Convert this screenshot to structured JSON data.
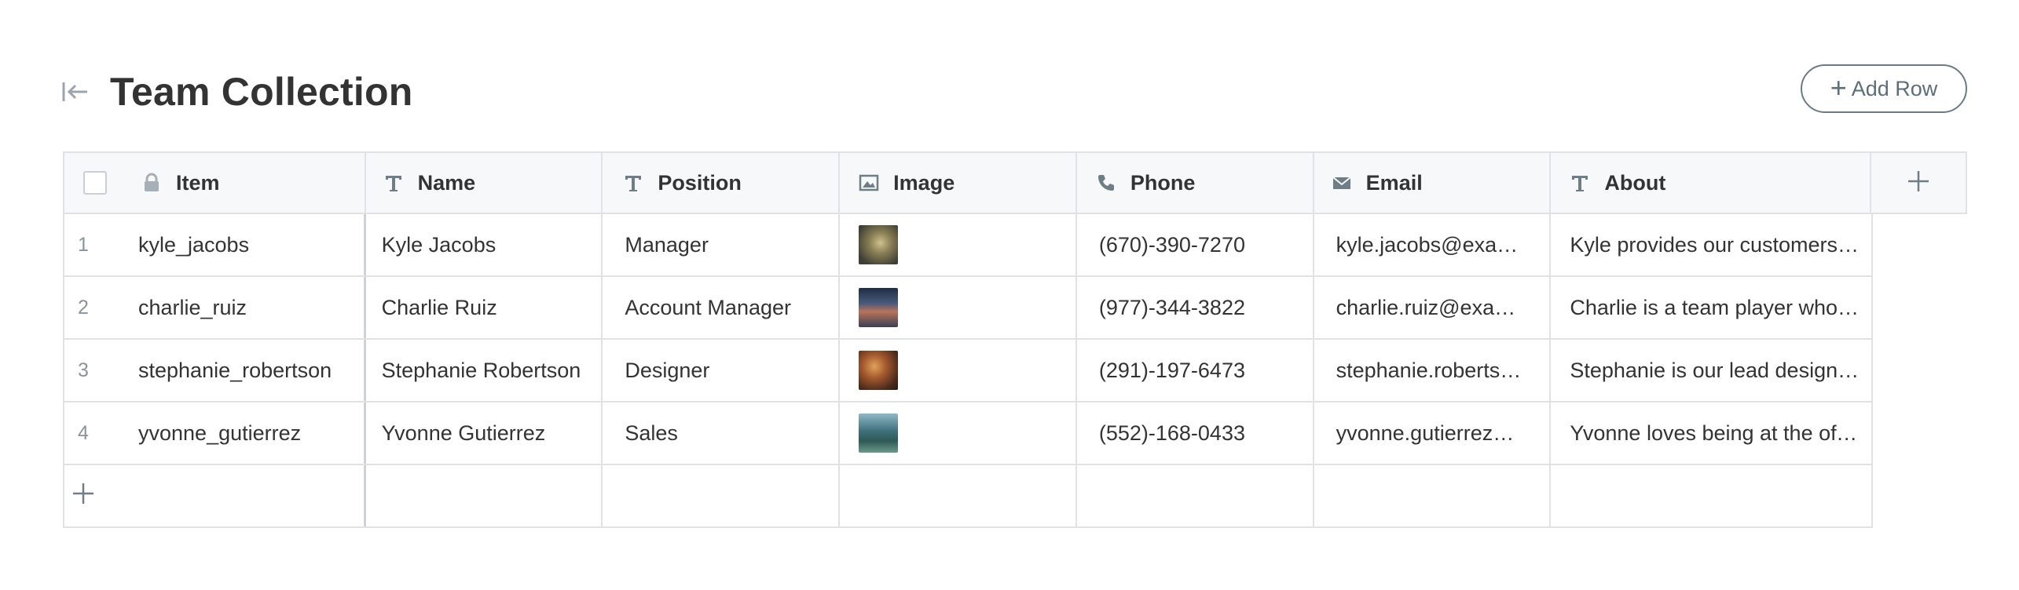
{
  "title": "Team Collection",
  "add_row_label": "Add Row",
  "columns": [
    {
      "key": "item",
      "label": "Item",
      "icon": "lock-icon"
    },
    {
      "key": "name",
      "label": "Name",
      "icon": "text-type-icon"
    },
    {
      "key": "position",
      "label": "Position",
      "icon": "text-type-icon"
    },
    {
      "key": "image",
      "label": "Image",
      "icon": "image-icon"
    },
    {
      "key": "phone",
      "label": "Phone",
      "icon": "phone-icon"
    },
    {
      "key": "email",
      "label": "Email",
      "icon": "mail-icon"
    },
    {
      "key": "about",
      "label": "About",
      "icon": "text-type-icon"
    }
  ],
  "rows": [
    {
      "index": "1",
      "item": "kyle_jacobs",
      "name": "Kyle Jacobs",
      "position": "Manager",
      "phone": "(670)-390-7270",
      "email": "kyle.jacobs@exam…",
      "about": "Kyle provides our customers …"
    },
    {
      "index": "2",
      "item": "charlie_ruiz",
      "name": "Charlie Ruiz",
      "position": "Account Manager",
      "phone": "(977)-344-3822",
      "email": "charlie.ruiz@exam…",
      "about": "Charlie is a team player who'…"
    },
    {
      "index": "3",
      "item": "stephanie_robertson",
      "name": "Stephanie Robertson",
      "position": "Designer",
      "phone": "(291)-197-6473",
      "email": "stephanie.robertso…",
      "about": "Stephanie is our lead design…"
    },
    {
      "index": "4",
      "item": "yvonne_gutierrez",
      "name": "Yvonne Gutierrez",
      "position": "Sales",
      "phone": "(552)-168-0433",
      "email": "yvonne.gutierrez@…",
      "about": "Yvonne loves being at the off…"
    }
  ]
}
